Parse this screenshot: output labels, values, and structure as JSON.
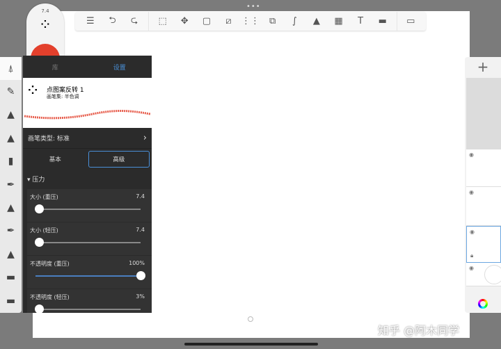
{
  "brush_pill": {
    "size": "7.4",
    "color": "#e3402c"
  },
  "toolbar": {
    "icons": [
      "list-icon",
      "undo-icon",
      "redo-icon",
      "select-icon",
      "transform-icon",
      "copy-icon",
      "ruler-icon",
      "symmetry-icon",
      "shapes-icon",
      "curve-icon",
      "image-add-icon",
      "perspective-icon",
      "text-icon",
      "video-icon",
      "fullscreen-icon"
    ],
    "glyphs": [
      "☰",
      "⮌",
      "⮎",
      "⬚",
      "✥",
      "▢",
      "⧄",
      "⋮⋮",
      "⧉",
      "∫",
      "▲",
      "▦",
      "T",
      "▬",
      "▭"
    ]
  },
  "panel": {
    "tabs": [
      "库",
      "设置"
    ],
    "brush_name": "点图案反转 1",
    "brush_set": "画笔集: 半色调",
    "brush_type": "画笔类型: 标准",
    "modes": [
      "基本",
      "高级"
    ],
    "section": "▾ 压力",
    "sliders": [
      {
        "label": "大小 (重压)",
        "value": "7.4",
        "fraction": 0.03
      },
      {
        "label": "大小 (轻压)",
        "value": "7.4",
        "fraction": 0.03
      },
      {
        "label": "不透明度 (重压)",
        "value": "100%",
        "fraction": 1.0
      },
      {
        "label": "不透明度 (轻压)",
        "value": "3%",
        "fraction": 0.03
      }
    ]
  },
  "watermark": "知乎 @阿木同学"
}
